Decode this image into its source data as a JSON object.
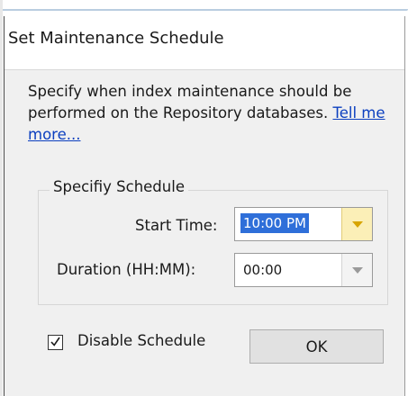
{
  "dialog": {
    "title": "Set Maintenance Schedule",
    "description": "Specify when index maintenance should be performed on the Repository databases.",
    "link_text": "Tell me more..."
  },
  "schedule": {
    "group_label": "Specifiy Schedule",
    "start_time_label": "Start Time:",
    "start_time_value": "10:00 PM",
    "duration_label": "Duration (HH:MM):",
    "duration_value": "00:00"
  },
  "footer": {
    "disable_label": "Disable Schedule",
    "disable_checked": true,
    "ok_label": "OK"
  },
  "colors": {
    "selection": "#2f6fd9",
    "link": "#0b3fbf",
    "combo_hover": "#fbefb7"
  },
  "icons": {
    "start_time_dropdown": "chevron-down-icon",
    "duration_dropdown": "chevron-down-icon",
    "checkbox": "checkmark-icon"
  }
}
